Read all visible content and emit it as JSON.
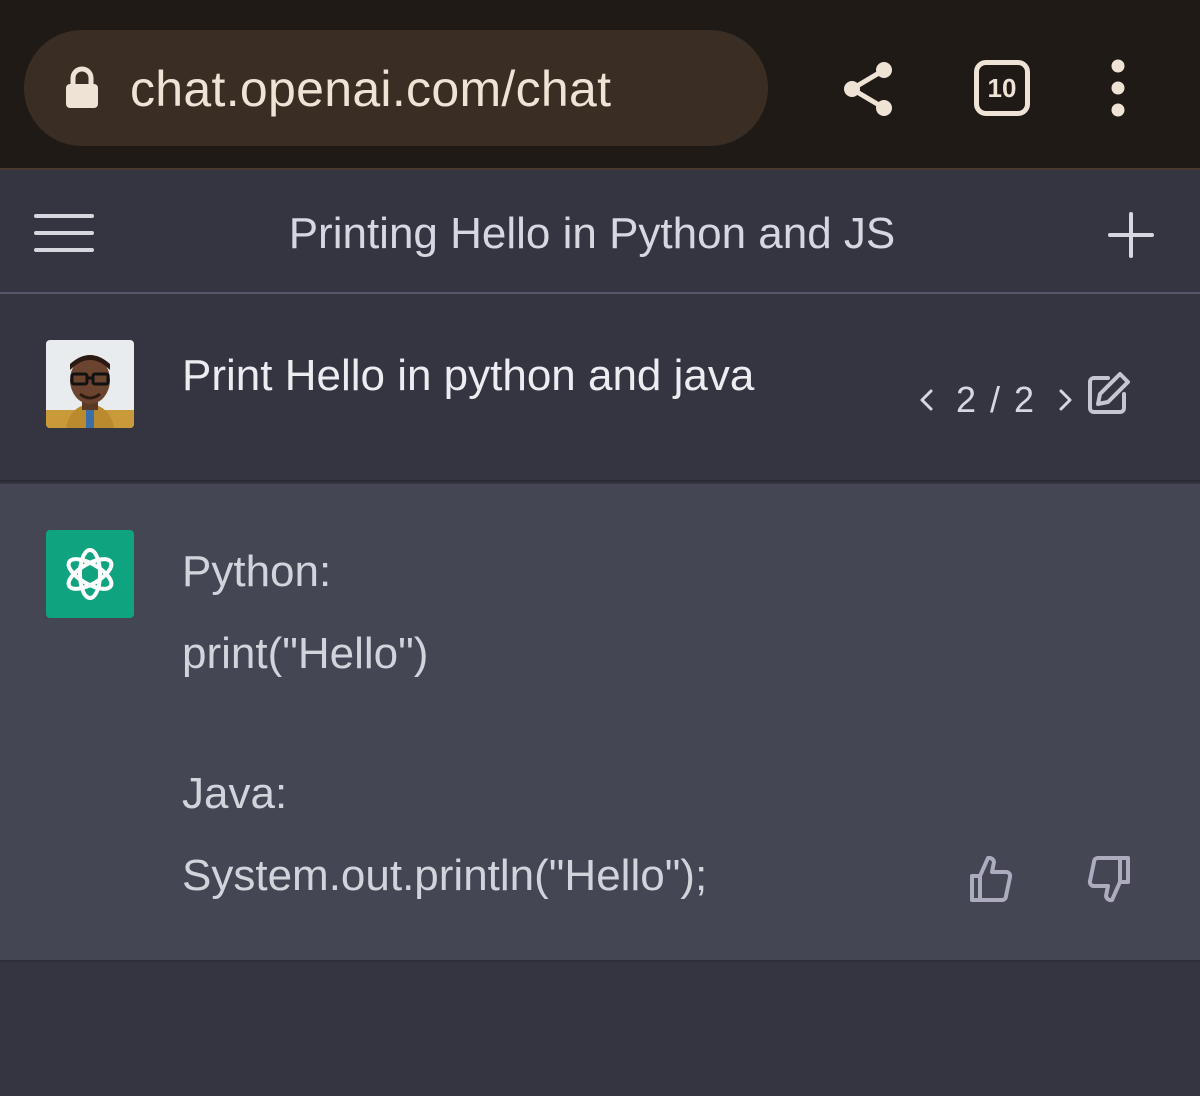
{
  "browser": {
    "url": "chat.openai.com/chat",
    "tab_count": "10",
    "icons": {
      "lock": "lock-icon",
      "share": "share-icon",
      "menu": "more-vertical-icon"
    },
    "colors": {
      "toolbar_bg": "#1f1a16",
      "pill_bg": "#3a2e24",
      "text": "#efe3d6"
    }
  },
  "header": {
    "title": "Printing Hello in Python and JS",
    "icons": {
      "menu": "hamburger-icon",
      "new_chat": "plus-icon"
    }
  },
  "conversation": {
    "user_message": {
      "text": "Print Hello in python and java",
      "pager": "2 / 2",
      "icons": {
        "prev": "chevron-left-icon",
        "next": "chevron-right-icon",
        "edit": "edit-icon"
      }
    },
    "assistant_message": {
      "lines": [
        "Python:",
        "print(\"Hello\")",
        "",
        "Java:",
        "System.out.println(\"Hello\");"
      ],
      "icons": {
        "like": "thumbs-up-icon",
        "dislike": "thumbs-down-icon"
      }
    }
  },
  "colors": {
    "page_bg": "#343541",
    "assistant_bg": "#444654",
    "brand_green": "#10a37f"
  }
}
